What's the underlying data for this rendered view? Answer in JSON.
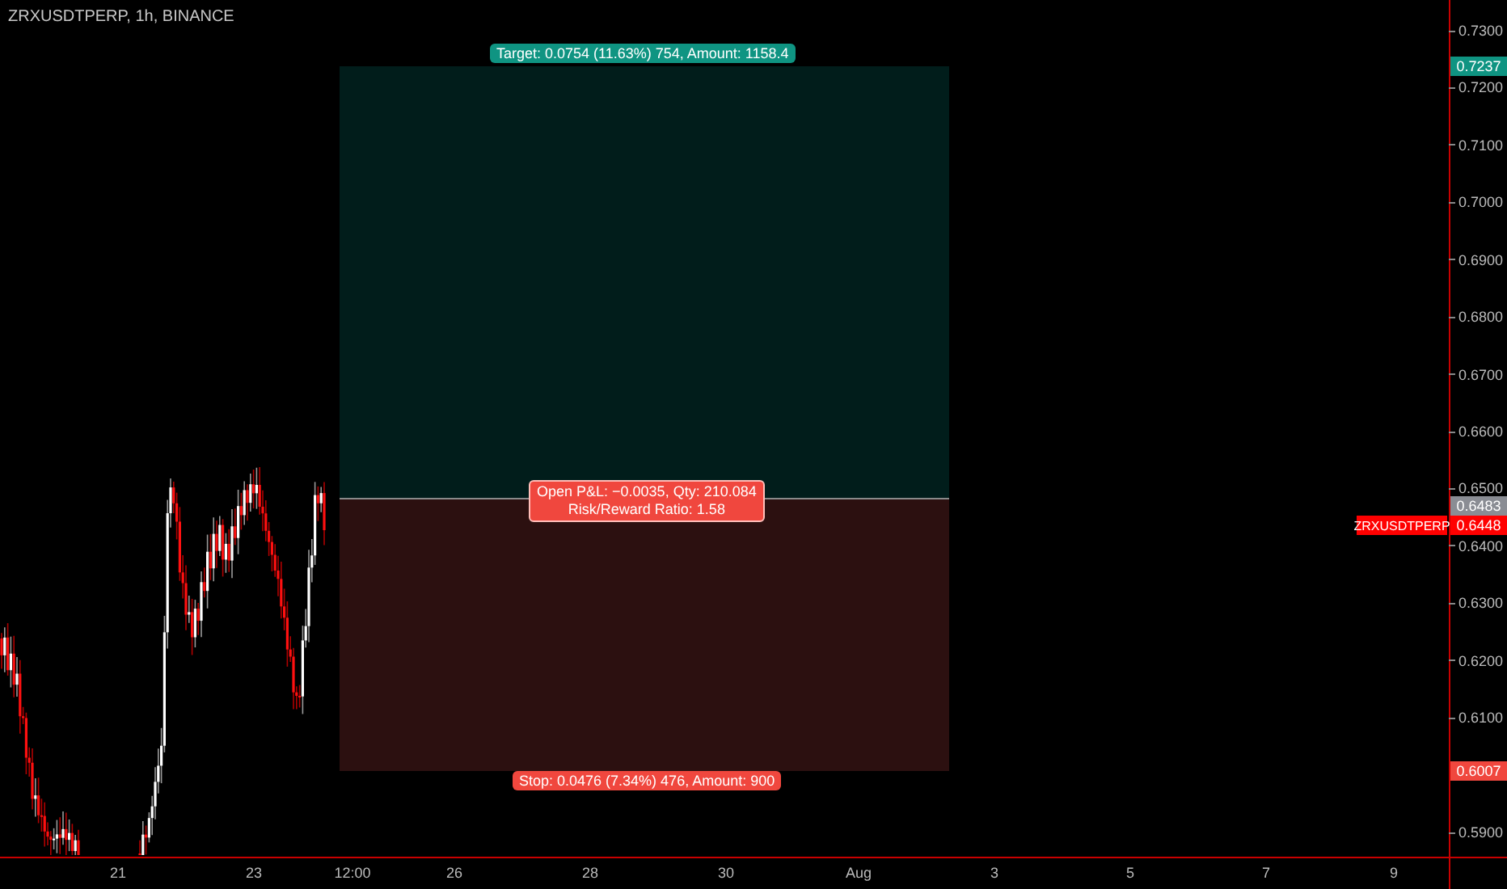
{
  "header": {
    "title": "ZRXUSDTPERP, 1h, BINANCE"
  },
  "position": {
    "target_label": "Target: 0.0754 (11.63%) 754, Amount: 1158.4",
    "pnl_lines": [
      "Open P&L: −0.0035, Qty: 210.084",
      "Risk/Reward Ratio: 1.58"
    ],
    "stop_label": "Stop: 0.0476 (7.34%) 476, Amount: 900"
  },
  "price_axis": {
    "ticks": [
      "0.7300",
      "0.7200",
      "0.7100",
      "0.7000",
      "0.6900",
      "0.6800",
      "0.6700",
      "0.6600",
      "0.6500",
      "0.6400",
      "0.6300",
      "0.6200",
      "0.6100",
      "0.5900"
    ],
    "markers": [
      {
        "kind": "target",
        "label": "0.7237"
      },
      {
        "kind": "entry",
        "label": "0.6483"
      },
      {
        "kind": "last",
        "label": "0.6448",
        "symbol": "ZRXUSDTPERP"
      },
      {
        "kind": "stop",
        "label": "0.6007"
      }
    ]
  },
  "time_axis": {
    "labels": [
      "21",
      "23",
      "12:00",
      "26",
      "28",
      "30",
      "Aug",
      "3",
      "5",
      "7",
      "9"
    ]
  }
}
